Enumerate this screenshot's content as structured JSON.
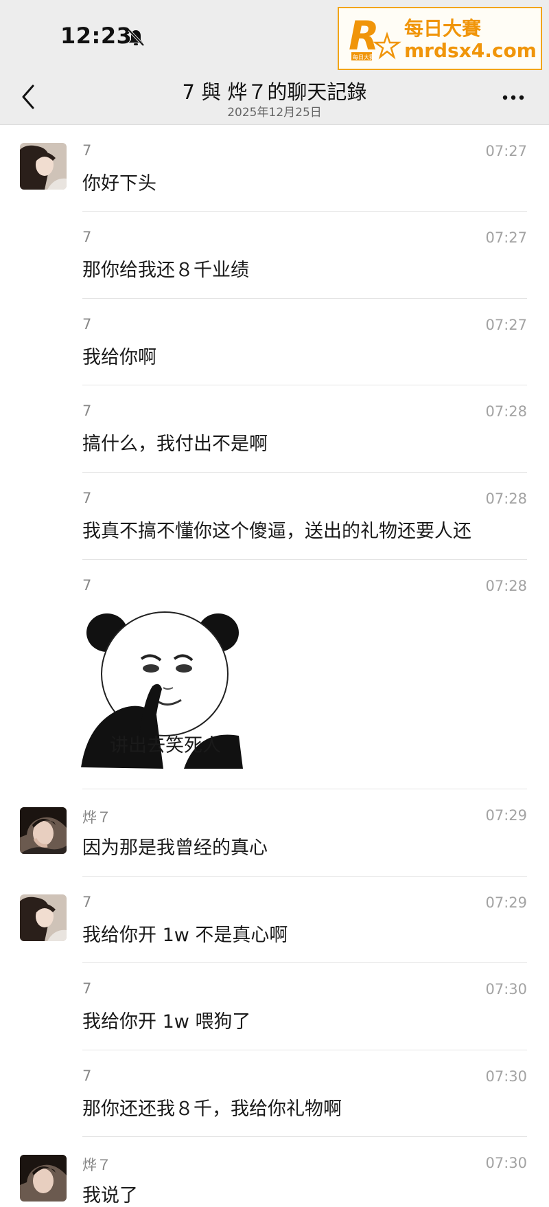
{
  "status_bar": {
    "time": "12:23",
    "mute_icon": "bell-slash-icon"
  },
  "watermark": {
    "brand": "每日大賽",
    "url": "mrdsx4.com",
    "logo_letter": "R",
    "logo_tag": "每日大賽",
    "color": "#f0950a"
  },
  "nav": {
    "title": "7 與 烨７的聊天記錄",
    "subtitle": "2025年12月25日",
    "back_icon": "chevron-left-icon",
    "more_icon": "more-dots-icon"
  },
  "messages": [
    {
      "sender": "7",
      "time": "07:27",
      "text": "你好下头"
    },
    {
      "sender": "7",
      "time": "07:27",
      "text": "那你给我还８千业绩"
    },
    {
      "sender": "7",
      "time": "07:27",
      "text": "我给你啊"
    },
    {
      "sender": "7",
      "time": "07:28",
      "text": "搞什么，我付出不是啊"
    },
    {
      "sender": "7",
      "time": "07:28",
      "text": "我真不搞不懂你这个傻逼，送出的礼物还要人还"
    },
    {
      "sender": "7",
      "time": "07:28",
      "text": "讲出去笑死人"
    },
    {
      "sender": "烨７",
      "time": "07:29",
      "text": "因为那是我曾经的真心"
    },
    {
      "sender": "7",
      "time": "07:29",
      "text": "我给你开 1w 不是真心啊"
    },
    {
      "sender": "7",
      "time": "07:30",
      "text": "我给你开 1w 喂狗了"
    },
    {
      "sender": "7",
      "time": "07:30",
      "text": "那你还还我８千，我给你礼物啊"
    },
    {
      "sender": "烨７",
      "time": "07:30",
      "text": "我说了"
    }
  ]
}
